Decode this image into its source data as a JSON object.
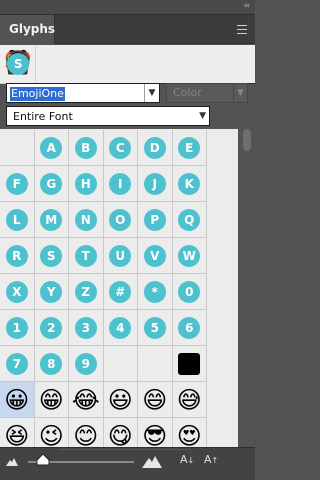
{
  "panel": {
    "title": "Glyphs",
    "collapse_symbol": "‹‹"
  },
  "recent_glyphs": [
    "🐭",
    "❤️",
    "🙌🏿",
    "👩🏾",
    "🐲",
    "😊",
    "S"
  ],
  "font_family": {
    "value": "EmojiOne"
  },
  "font_style": {
    "placeholder": "Color"
  },
  "glyph_range": {
    "value": "Entire Font"
  },
  "glyphs": [
    {
      "type": "empty"
    },
    {
      "type": "badge",
      "text": "A"
    },
    {
      "type": "badge",
      "text": "B"
    },
    {
      "type": "badge",
      "text": "C"
    },
    {
      "type": "badge",
      "text": "D"
    },
    {
      "type": "badge",
      "text": "E"
    },
    {
      "type": "badge",
      "text": "F"
    },
    {
      "type": "badge",
      "text": "G"
    },
    {
      "type": "badge",
      "text": "H"
    },
    {
      "type": "badge",
      "text": "I"
    },
    {
      "type": "badge",
      "text": "J"
    },
    {
      "type": "badge",
      "text": "K"
    },
    {
      "type": "badge",
      "text": "L"
    },
    {
      "type": "badge",
      "text": "M"
    },
    {
      "type": "badge",
      "text": "N"
    },
    {
      "type": "badge",
      "text": "O"
    },
    {
      "type": "badge",
      "text": "P"
    },
    {
      "type": "badge",
      "text": "Q"
    },
    {
      "type": "badge",
      "text": "R"
    },
    {
      "type": "badge",
      "text": "S"
    },
    {
      "type": "badge",
      "text": "T"
    },
    {
      "type": "badge",
      "text": "U"
    },
    {
      "type": "badge",
      "text": "V"
    },
    {
      "type": "badge",
      "text": "W"
    },
    {
      "type": "badge",
      "text": "X"
    },
    {
      "type": "badge",
      "text": "Y"
    },
    {
      "type": "badge",
      "text": "Z"
    },
    {
      "type": "badge",
      "text": "#"
    },
    {
      "type": "badge",
      "text": "*"
    },
    {
      "type": "badge",
      "text": "0"
    },
    {
      "type": "badge",
      "text": "1"
    },
    {
      "type": "badge",
      "text": "2"
    },
    {
      "type": "badge",
      "text": "3"
    },
    {
      "type": "badge",
      "text": "4"
    },
    {
      "type": "badge",
      "text": "5"
    },
    {
      "type": "badge",
      "text": "6"
    },
    {
      "type": "badge",
      "text": "7"
    },
    {
      "type": "badge",
      "text": "8"
    },
    {
      "type": "badge",
      "text": "9"
    },
    {
      "type": "empty"
    },
    {
      "type": "empty"
    },
    {
      "type": "black"
    },
    {
      "type": "emoji",
      "text": "😀",
      "selected": true
    },
    {
      "type": "emoji",
      "text": "😁"
    },
    {
      "type": "emoji",
      "text": "😂"
    },
    {
      "type": "emoji",
      "text": "😃"
    },
    {
      "type": "emoji",
      "text": "😄"
    },
    {
      "type": "emoji",
      "text": "😅"
    },
    {
      "type": "emoji",
      "text": "😆"
    },
    {
      "type": "emoji",
      "text": "😉"
    },
    {
      "type": "emoji",
      "text": "😊"
    },
    {
      "type": "emoji",
      "text": "😋"
    },
    {
      "type": "emoji",
      "text": "😎"
    },
    {
      "type": "emoji",
      "text": "😍"
    }
  ],
  "footer": {
    "font_down_label": "A",
    "font_up_label": "A"
  }
}
